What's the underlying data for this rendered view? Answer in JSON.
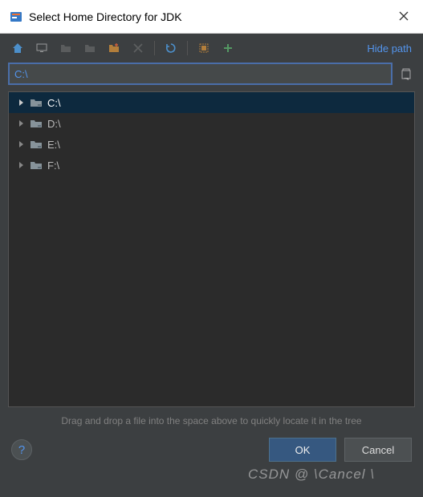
{
  "title": "Select Home Directory for JDK",
  "hide_path_label": "Hide path",
  "path_value": "C:\\",
  "drag_hint": "Drag and drop a file into the space above to quickly locate it in the tree",
  "buttons": {
    "ok": "OK",
    "cancel": "Cancel",
    "help": "?"
  },
  "drives": [
    {
      "label": "C:\\",
      "selected": true
    },
    {
      "label": "D:\\",
      "selected": false
    },
    {
      "label": "E:\\",
      "selected": false
    },
    {
      "label": "F:\\",
      "selected": false
    }
  ],
  "watermark": "CSDN @ \\Cancel \\"
}
